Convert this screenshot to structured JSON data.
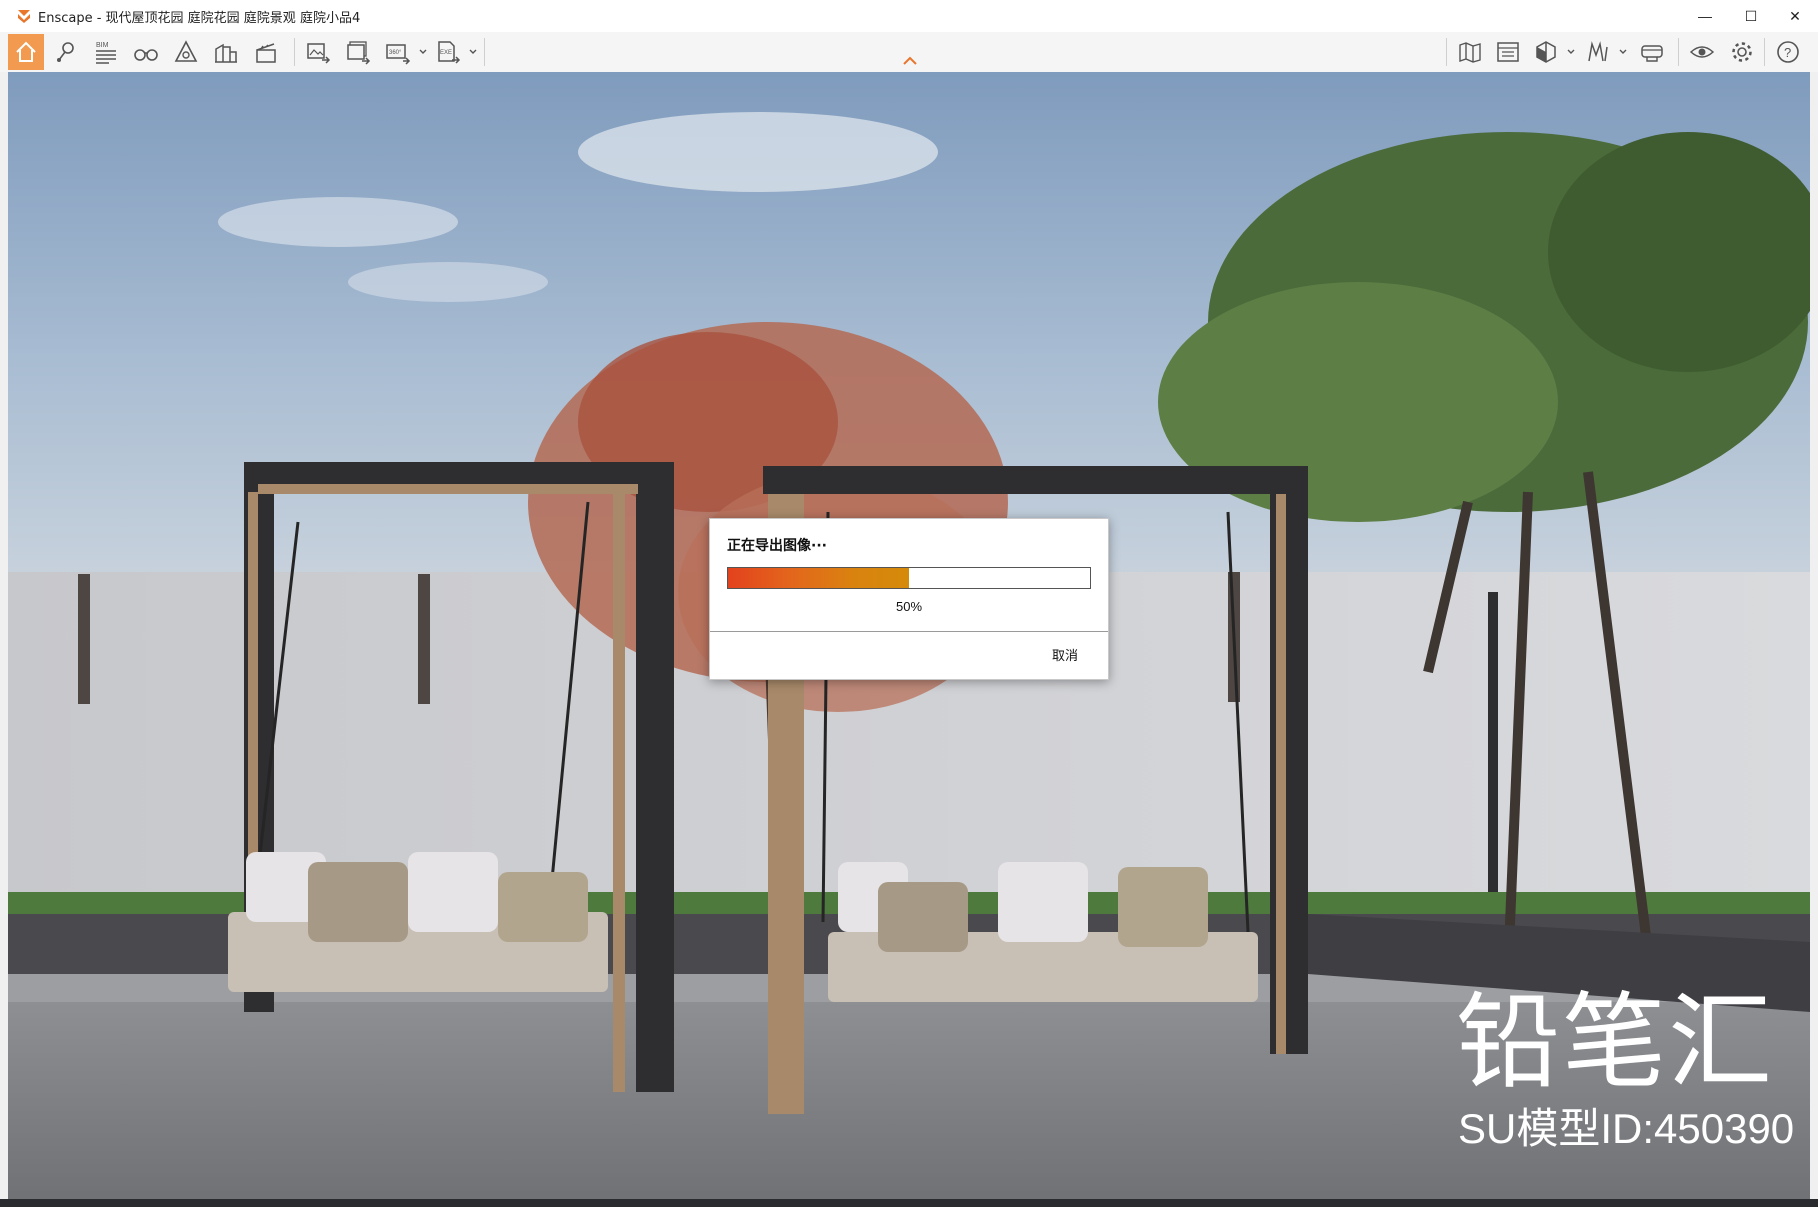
{
  "window": {
    "title": "Enscape - 现代屋顶花园 庭院花园 庭院景观 庭院小品4",
    "controls": {
      "minimize": "—",
      "maximize": "☐",
      "close": "✕"
    }
  },
  "toolbar": {
    "left_items": [
      {
        "name": "home",
        "icon": "home-icon",
        "active": true
      },
      {
        "name": "walk-mode",
        "icon": "walk-pin-icon"
      },
      {
        "name": "bim",
        "icon": "bim-list-icon",
        "label": "BIM"
      },
      {
        "name": "binoculars",
        "icon": "binoculars-icon"
      },
      {
        "name": "visual-settings",
        "icon": "alert-triangle-icon"
      },
      {
        "name": "asset-library",
        "icon": "buildings-icon"
      },
      {
        "name": "clapperboard",
        "icon": "clapperboard-icon"
      },
      {
        "name": "screenshot",
        "icon": "image-export-icon"
      },
      {
        "name": "batch-render",
        "icon": "batch-export-icon"
      },
      {
        "name": "panorama",
        "icon": "panorama-icon",
        "label": "360°"
      },
      {
        "name": "exe-export",
        "icon": "exe-export-icon",
        "label": "EXE"
      }
    ],
    "right_items": [
      {
        "name": "map",
        "icon": "map-icon"
      },
      {
        "name": "views",
        "icon": "views-icon"
      },
      {
        "name": "cube",
        "icon": "cube-icon"
      },
      {
        "name": "sections",
        "icon": "sections-icon"
      },
      {
        "name": "vr-headset",
        "icon": "vr-icon"
      },
      {
        "name": "visibility",
        "icon": "eye-icon"
      },
      {
        "name": "settings",
        "icon": "gear-icon"
      },
      {
        "name": "help",
        "icon": "help-icon"
      }
    ]
  },
  "dialog": {
    "title": "正在导出图像···",
    "progress_percent": 50,
    "percent_label": "50%",
    "cancel_label": "取消",
    "colors": {
      "fill_start": "#e3421d",
      "fill_end": "#d58a0a"
    }
  },
  "watermark": {
    "brand": "铅笔汇",
    "model_id": "SU模型ID:450390"
  },
  "colors": {
    "accent": "#f29a50",
    "logo": "#e8762c"
  }
}
